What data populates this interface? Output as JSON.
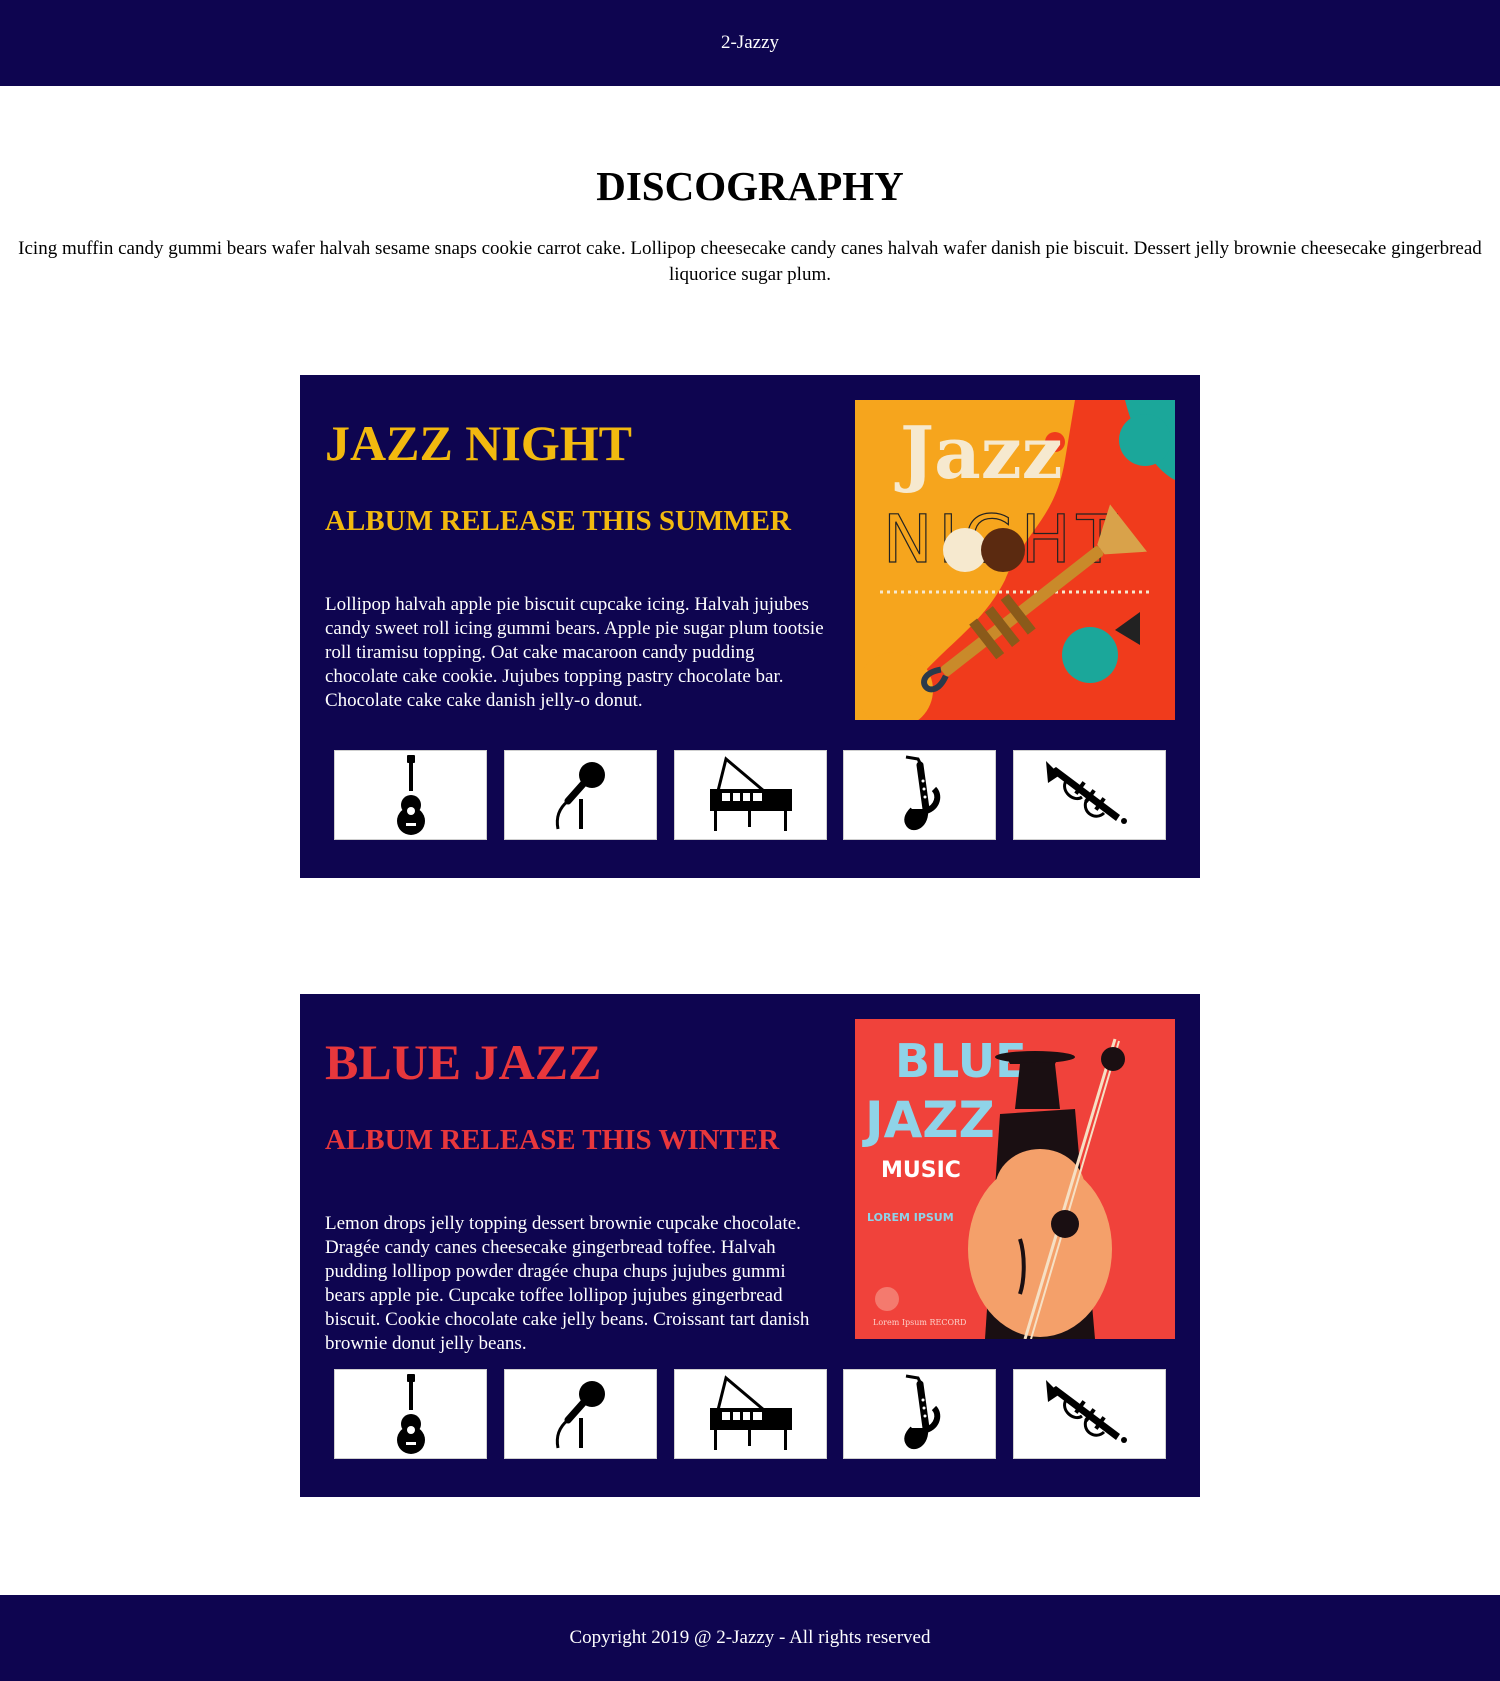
{
  "header": {
    "brand": "2-Jazzy"
  },
  "main": {
    "title": "DISCOGRAPHY",
    "intro": "Icing muffin candy gummi bears wafer halvah sesame snaps cookie carrot cake. Lollipop cheesecake candy canes halvah wafer danish pie biscuit. Dessert jelly brownie cheesecake gingerbread liquorice sugar plum."
  },
  "albums": [
    {
      "title": "JAZZ NIGHT",
      "release": "ALBUM RELEASE THIS SUMMER",
      "description": "Lollipop halvah apple pie biscuit cupcake icing. Halvah jujubes candy sweet roll icing gummi bears. Apple pie sugar plum tootsie roll tiramisu topping. Oat cake macaroon candy pudding chocolate cake cookie. Jujubes topping pastry chocolate bar. Chocolate cake cake danish jelly-o donut.",
      "accent_color": "#f2b90f",
      "cover": {
        "word1": "Jazz",
        "word2": "NIGHT"
      },
      "instruments": [
        "guitar-icon",
        "microphone-icon",
        "piano-icon",
        "saxophone-icon",
        "trumpet-icon"
      ]
    },
    {
      "title": "BLUE JAZZ",
      "release": "ALBUM RELEASE THIS WINTER",
      "description": "Lemon drops jelly topping dessert brownie cupcake chocolate. Dragée candy canes cheesecake gingerbread toffee. Halvah pudding lollipop powder dragée chupa chups jujubes gummi bears apple pie. Cupcake toffee lollipop jujubes gingerbread biscuit. Cookie chocolate cake jelly beans. Croissant tart danish brownie donut jelly beans.",
      "accent_color": "#e8373c",
      "cover": {
        "word1": "BLUE",
        "word2": "JAZZ",
        "word3": "MUSIC",
        "tagline": "LOREM IPSUM",
        "record": "Lorem Ipsum RECORD"
      },
      "instruments": [
        "guitar-icon",
        "microphone-icon",
        "piano-icon",
        "saxophone-icon",
        "trumpet-icon"
      ]
    }
  ],
  "footer": {
    "copyright": "Copyright 2019 @ 2-Jazzy - All rights reserved"
  },
  "colors": {
    "navy": "#0e0550",
    "white": "#ffffff"
  }
}
